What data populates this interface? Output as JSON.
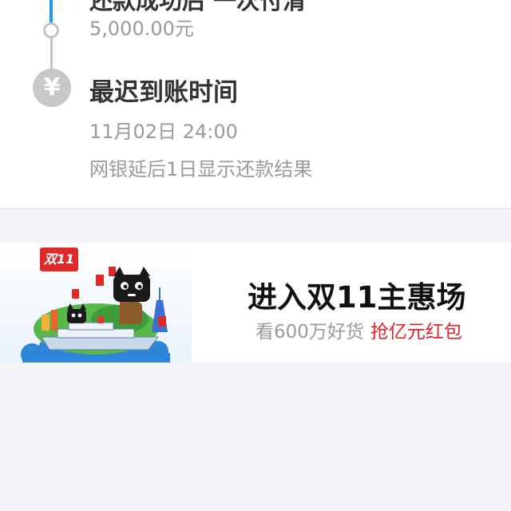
{
  "timeline": {
    "prev_step": {
      "title": "还款成功后 一次付清",
      "amount": "5,000.00元"
    },
    "current_step": {
      "icon": "yen-icon",
      "icon_glyph": "¥",
      "title": "最迟到账时间",
      "date": "11月02日 24:00",
      "note": "网银延后1日显示还款结果"
    },
    "colors": {
      "active_line": "#1e9be8",
      "inactive_line": "#c4c4c4"
    }
  },
  "promo_banner": {
    "badge": "双11",
    "title": "进入双11主惠场",
    "subtitle_grey": "看600万好货",
    "subtitle_red": "抢亿元红包",
    "accent_color": "#e0242b"
  }
}
